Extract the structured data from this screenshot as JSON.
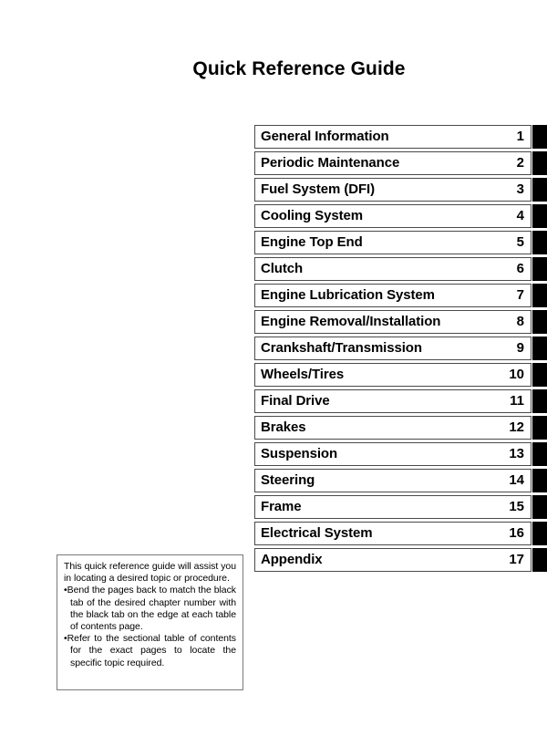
{
  "page": {
    "title": "Quick Reference Guide",
    "background_color": "#ffffff",
    "text_color": "#000000",
    "tab_color": "#000000"
  },
  "toc": {
    "rows": [
      {
        "label": "General Information",
        "number": "1"
      },
      {
        "label": "Periodic Maintenance",
        "number": "2"
      },
      {
        "label": "Fuel System (DFI)",
        "number": "3"
      },
      {
        "label": "Cooling System",
        "number": "4"
      },
      {
        "label": "Engine Top End",
        "number": "5"
      },
      {
        "label": "Clutch",
        "number": "6"
      },
      {
        "label": "Engine Lubrication System",
        "number": "7"
      },
      {
        "label": "Engine Removal/Installation",
        "number": "8"
      },
      {
        "label": "Crankshaft/Transmission",
        "number": "9"
      },
      {
        "label": "Wheels/Tires",
        "number": "10"
      },
      {
        "label": "Final Drive",
        "number": "11"
      },
      {
        "label": "Brakes",
        "number": "12"
      },
      {
        "label": "Suspension",
        "number": "13"
      },
      {
        "label": "Steering",
        "number": "14"
      },
      {
        "label": "Frame",
        "number": "15"
      },
      {
        "label": "Electrical System",
        "number": "16"
      },
      {
        "label": "Appendix",
        "number": "17"
      }
    ]
  },
  "note": {
    "intro": "This quick reference guide will assist you in locating a desired topic or procedure.",
    "bullets": [
      "Bend the pages back to match the black tab of the desired chapter number with the black tab on the edge at each table of contents page.",
      "Refer to the sectional table of contents for the exact pages to locate the specific topic required."
    ],
    "bullet_glyph": "•"
  }
}
